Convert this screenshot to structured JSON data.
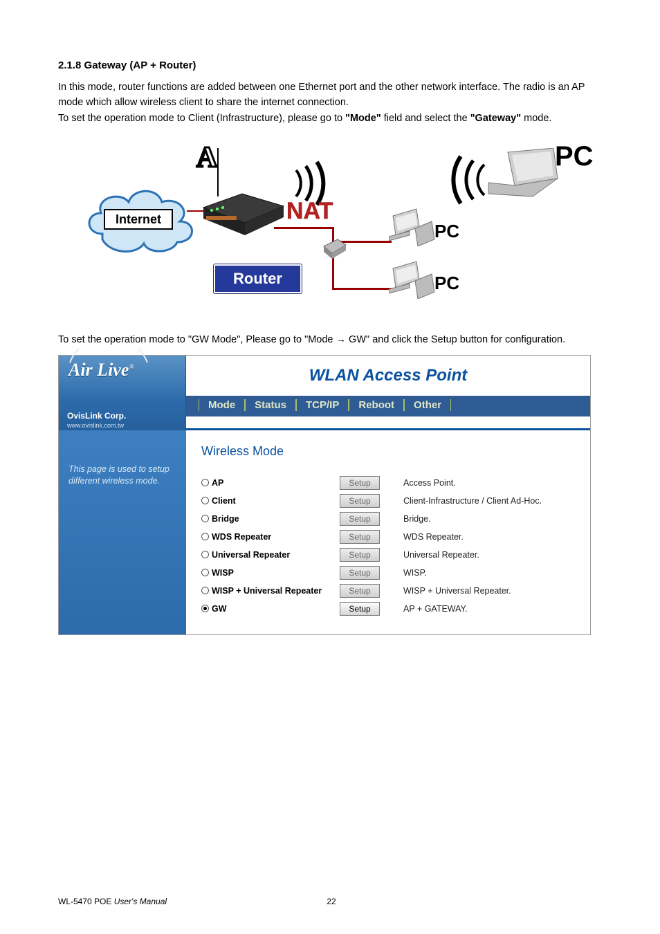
{
  "section": {
    "number": "2.1.8",
    "title": "Gateway (AP + Router)"
  },
  "para1": "In this mode, router functions are added between one Ethernet port and the other network interface. The radio is an AP mode which allow wireless client to share the internet connection.",
  "para2a": "To set the operation mode to Client (Infrastructure), please go to ",
  "para2_mode": "\"Mode\"",
  "para2b": " field and select the ",
  "para2_gateway": "\"Gateway\"",
  "para2c": " mode.",
  "diagram": {
    "internet": "Internet",
    "nat": "NAT",
    "router": "Router",
    "pc": "PC",
    "letterA": "A"
  },
  "para3a": "To set the operation mode to \"GW Mode\", Please go to \"Mode ",
  "arrow": "→",
  "para3b": " GW\" and click the Setup button for configuration.",
  "app": {
    "brand": {
      "name": "Air Live",
      "corp": "OvisLink Corp.",
      "url": "www.ovislink.com.tw"
    },
    "title": "WLAN Access Point",
    "tabs": [
      "Mode",
      "Status",
      "TCP/IP",
      "Reboot",
      "Other"
    ],
    "sidebar": "This page is used to setup different wireless mode.",
    "section_title": "Wireless Mode",
    "setup_label": "Setup",
    "modes": [
      {
        "label": "AP",
        "desc": "Access Point.",
        "selected": false,
        "enabled": false
      },
      {
        "label": "Client",
        "desc": "Client-Infrastructure / Client Ad-Hoc.",
        "selected": false,
        "enabled": false
      },
      {
        "label": "Bridge",
        "desc": "Bridge.",
        "selected": false,
        "enabled": false
      },
      {
        "label": "WDS Repeater",
        "desc": "WDS Repeater.",
        "selected": false,
        "enabled": false
      },
      {
        "label": "Universal Repeater",
        "desc": "Universal Repeater.",
        "selected": false,
        "enabled": false
      },
      {
        "label": "WISP",
        "desc": "WISP.",
        "selected": false,
        "enabled": false
      },
      {
        "label": "WISP + Universal Repeater",
        "desc": "WISP + Universal Repeater.",
        "selected": false,
        "enabled": false
      },
      {
        "label": "GW",
        "desc": "AP + GATEWAY.",
        "selected": true,
        "enabled": true
      }
    ]
  },
  "footer": {
    "model": "WL-5470 POE",
    "manual": "User's Manual",
    "page": "22"
  }
}
